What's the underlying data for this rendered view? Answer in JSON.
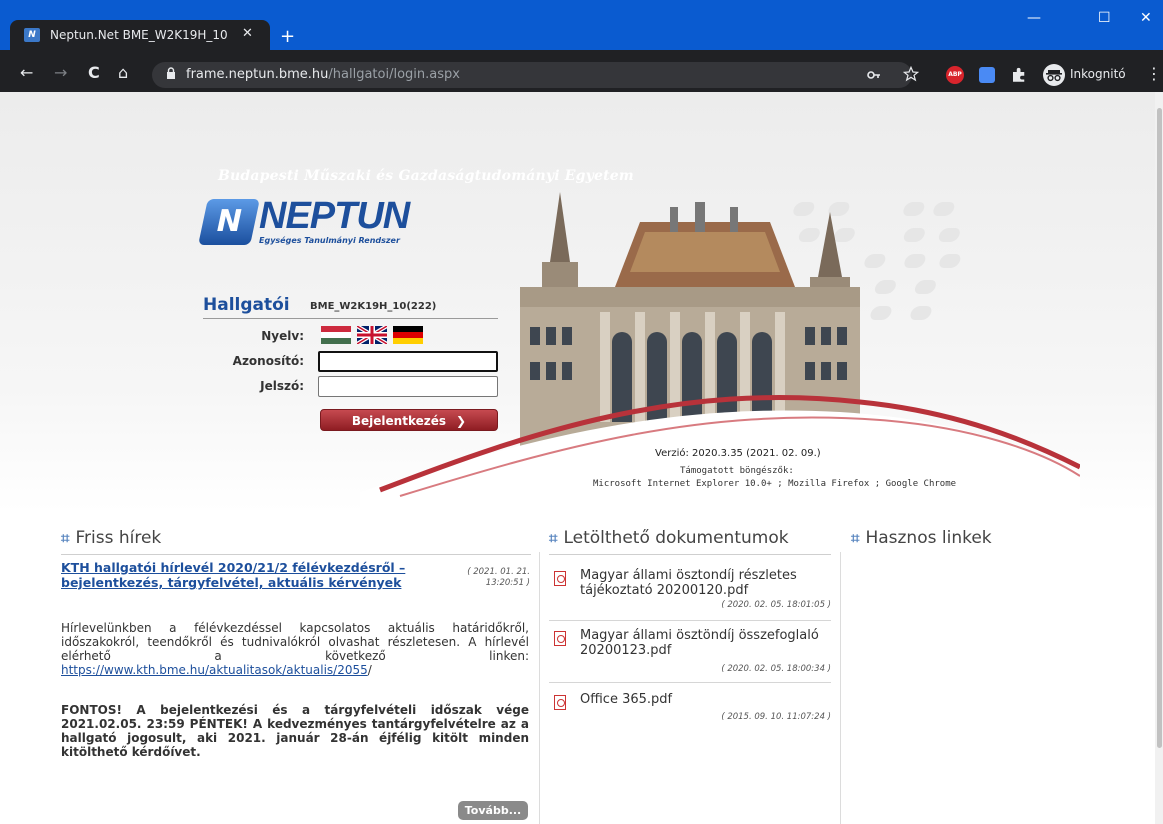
{
  "browser": {
    "tab_title": "Neptun.Net BME_W2K19H_10",
    "tab_close": "✕",
    "new_tab": "+",
    "url_host": "frame.neptun.bme.hu",
    "url_path": "/hallgatoi/login.aspx",
    "incognito_label": "Inkognitó",
    "abp_label": "ABP",
    "window_controls": [
      "—",
      "☐",
      "✕"
    ],
    "nav": [
      "←",
      "→",
      "C",
      "⌂"
    ]
  },
  "header": {
    "university": "Budapesti Műszaki és Gazdaságtudományi Egyetem",
    "logo_mark": "N",
    "logo_word": "NEPTUN",
    "logo_sub": "Egységes Tanulmányi Rendszer"
  },
  "login": {
    "title": "Hallgatói",
    "server_code": "BME_W2K19H_10(222)",
    "language_label": "Nyelv:",
    "languages": [
      "hu",
      "en",
      "de"
    ],
    "username_label": "Azonosító:",
    "username_value": "",
    "password_label": "Jelszó:",
    "password_value": "",
    "submit_label": "Bejelentkezés",
    "submit_arrow": "❯"
  },
  "version": {
    "text": "Verzió: 2020.3.35 (2021. 02. 09.)",
    "supported_label": "Támogatott böngészők:",
    "supported_list": "Microsoft Internet Explorer 10.0+ ; Mozilla Firefox ; Google Chrome"
  },
  "news": {
    "heading": "Friss hírek",
    "hash_glyph": "⌗",
    "title": "KTH hallgatói hírlevél 2020/21/2 félévkezdésről – bejelentkezés, tárgyfelvétel, aktuális kérvények",
    "date": "( 2021. 01. 21. 13:20:51 )",
    "body": "Hírlevelünkben a félévkezdéssel kapcsolatos aktuális határidőkről, időszakokról, teendőkről és tudnivalókról olvashat részletesen. A hírlevél elérhető a következő linken: ",
    "link": "https://www.kth.bme.hu/aktualitasok/aktualis/2055",
    "link_suffix": "/",
    "bold_body": "FONTOS! A bejelentkezési és a tárgyfelvételi időszak vége 2021.02.05. 23:59 PÉNTEK! A kedvezményes tantárgyfelvételre az a hallgató jogosult, aki 2021. január 28-án éjfélig kitölt minden kitölthető kérdőívet.",
    "more_label": "Tovább..."
  },
  "documents": {
    "heading": "Letölthető dokumentumok",
    "items": [
      {
        "name": "Magyar állami ösztondíj részletes tájékoztató 20200120.pdf",
        "date": "( 2020. 02. 05. 18:01:05 )"
      },
      {
        "name": "Magyar állami ösztöndíj összefoglaló 20200123.pdf",
        "date": "( 2020. 02. 05. 18:00:34 )"
      },
      {
        "name": "Office 365.pdf",
        "date": "( 2015. 09. 10. 11:07:24 )"
      }
    ]
  },
  "links": {
    "heading": "Hasznos linkek"
  },
  "colors": {
    "brand_blue": "#1d4f9c",
    "button_red": "#a62a31",
    "chrome_dark": "#202124",
    "tabbar_blue": "#0a5bd0"
  }
}
